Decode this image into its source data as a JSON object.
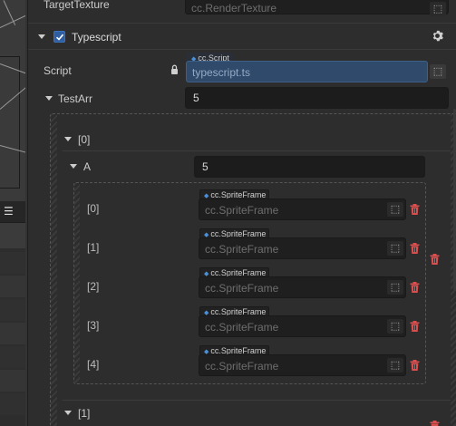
{
  "inspector": {
    "target_texture": {
      "label": "TargetTexture",
      "value": "cc.RenderTexture"
    },
    "component": {
      "name": "Typescript",
      "enabled": true,
      "settings_icon": "gear-icon"
    },
    "script": {
      "label": "Script",
      "type_tag": "cc.Script",
      "value": "typescript.ts"
    },
    "test_arr": {
      "label": "TestArr",
      "size": "5",
      "elements": [
        {
          "label": "[0]",
          "a": {
            "label": "A",
            "size": "5",
            "items": [
              {
                "label": "[0]",
                "type_tag": "cc.SpriteFrame",
                "value": "cc.SpriteFrame"
              },
              {
                "label": "[1]",
                "type_tag": "cc.SpriteFrame",
                "value": "cc.SpriteFrame"
              },
              {
                "label": "[2]",
                "type_tag": "cc.SpriteFrame",
                "value": "cc.SpriteFrame"
              },
              {
                "label": "[3]",
                "type_tag": "cc.SpriteFrame",
                "value": "cc.SpriteFrame"
              },
              {
                "label": "[4]",
                "type_tag": "cc.SpriteFrame",
                "value": "cc.SpriteFrame"
              }
            ]
          }
        },
        {
          "label": "[1]"
        }
      ]
    }
  },
  "left_panel": {
    "toolbar_icon": "list-icon"
  },
  "colors": {
    "background": "#2d2d2d",
    "field": "#1f1f1f",
    "script_field": "#304a6b",
    "accent_blue": "#2f5fa0",
    "delete_red": "#d94f4f",
    "tag_dot": "#4a90d9"
  }
}
